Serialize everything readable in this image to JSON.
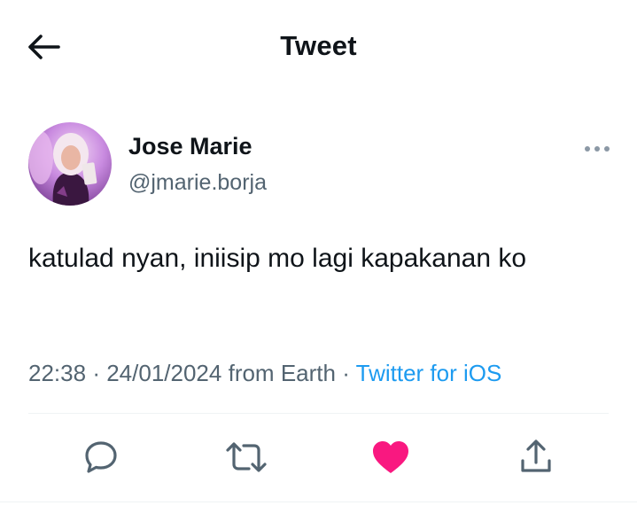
{
  "header": {
    "title": "Tweet",
    "back_icon": "arrow-left-icon"
  },
  "author": {
    "display_name": "Jose Marie",
    "handle": "@jmarie.borja",
    "more_icon": "ellipsis-icon"
  },
  "tweet": {
    "text": "katulad nyan, iniisip mo lagi kapakanan ko",
    "time": "22:38",
    "date": "24/01/2024",
    "location": "from Earth",
    "separator": "·",
    "source": "Twitter for iOS"
  },
  "actions": [
    {
      "name": "reply",
      "icon": "reply-icon"
    },
    {
      "name": "retweet",
      "icon": "retweet-icon"
    },
    {
      "name": "like",
      "icon": "heart-icon",
      "liked": true
    },
    {
      "name": "share",
      "icon": "share-icon"
    }
  ],
  "colors": {
    "text": "#0f1419",
    "secondary": "#536471",
    "link": "#1d9bf0",
    "like": "#f91880",
    "divider": "#eff3f4"
  }
}
